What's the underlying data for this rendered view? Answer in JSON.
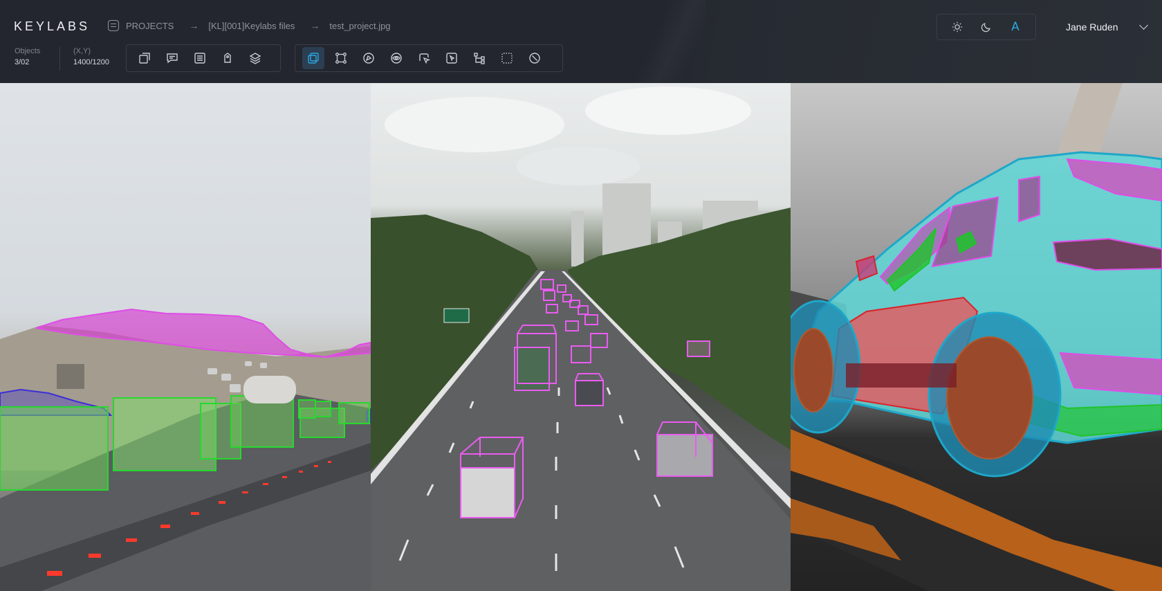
{
  "app": {
    "logo": "KEYLABS"
  },
  "breadcrumb": {
    "items": [
      "PROJECTS",
      "[KL][001]Keylabs files",
      "test_project.jpg"
    ],
    "separator": "→"
  },
  "info": {
    "objects_label": "Objects",
    "objects_value": "3/02",
    "xy_label": "(X,Y)",
    "xy_value": "1400/1200"
  },
  "toolbar": {
    "group1": [
      "crop-icon",
      "comment-icon",
      "list-icon",
      "tag-icon",
      "layers-icon"
    ],
    "group2": [
      "bounding-box-icon",
      "points-box-icon",
      "polygon-icon",
      "eye-target-icon",
      "cursor-select-icon",
      "magic-select-icon",
      "tree-icon",
      "dotted-box-icon",
      "slash-circle-icon"
    ],
    "active_tool": "bounding-box-icon"
  },
  "theme": {
    "options": [
      "sun-icon",
      "moon-icon",
      "A"
    ],
    "selected": "A",
    "accent": "#2aa8e0"
  },
  "user": {
    "name": "Jane Ruden"
  },
  "colors": {
    "segmentation_magenta": "#e04ce6",
    "box_green": "#27d82f",
    "box_blue": "#3b2fd6",
    "cuboid_pink": "#ea5cf1",
    "car_red": "#e8585c",
    "wheel_blue": "#1ea7c9",
    "window_green": "#1fc42a"
  }
}
